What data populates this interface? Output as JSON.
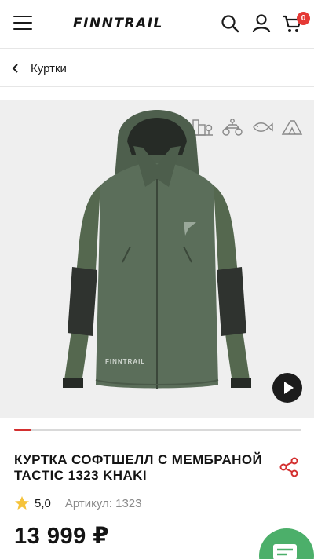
{
  "header": {
    "logo": "FINNTRAIL",
    "cart_count": "0",
    "icons": [
      "menu-icon",
      "search-icon",
      "user-icon",
      "cart-icon"
    ]
  },
  "breadcrumb": {
    "label": "Куртки"
  },
  "gallery": {
    "activity_icons": [
      "city-icon",
      "atv-icon",
      "fishing-icon",
      "tent-icon"
    ],
    "jacket_brand": "FINNTRAIL",
    "play_icon": "play-icon",
    "slide_current": 1
  },
  "product": {
    "title": "КУРТКА СОФТШЕЛЛ С МЕМБРАНОЙ TACTIC 1323 KHAKI",
    "rating": "5,0",
    "sku": "Артикул: 1323",
    "price": "13 999 ₽"
  },
  "colors": {
    "accent": "#d32f2f",
    "chat": "#4caf6a",
    "jacket": "#5b6e5a"
  }
}
